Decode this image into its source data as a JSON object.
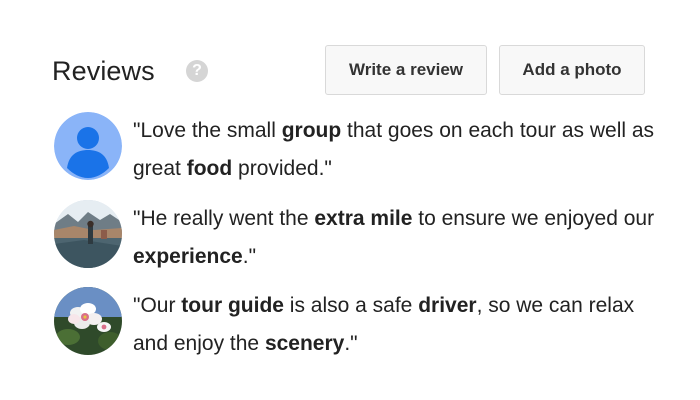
{
  "header": {
    "title": "Reviews",
    "help_icon_glyph": "?",
    "write_review_label": "Write a review",
    "add_photo_label": "Add a photo"
  },
  "reviews": [
    {
      "avatar": "default-user-avatar",
      "segments": [
        {
          "text": "\"Love the small ",
          "bold": false
        },
        {
          "text": "group",
          "bold": true
        },
        {
          "text": " that goes on each tour as well as great ",
          "bold": false
        },
        {
          "text": "food",
          "bold": true
        },
        {
          "text": " provided.\"",
          "bold": false
        }
      ]
    },
    {
      "avatar": "coastal-landscape-photo-avatar",
      "segments": [
        {
          "text": "\"He really went the ",
          "bold": false
        },
        {
          "text": "extra mile",
          "bold": true
        },
        {
          "text": " to ensure we enjoyed our ",
          "bold": false
        },
        {
          "text": "experience",
          "bold": true
        },
        {
          "text": ".\"",
          "bold": false
        }
      ]
    },
    {
      "avatar": "flower-blossom-photo-avatar",
      "segments": [
        {
          "text": "\"Our ",
          "bold": false
        },
        {
          "text": "tour guide",
          "bold": true
        },
        {
          "text": " is also a safe ",
          "bold": false
        },
        {
          "text": "driver",
          "bold": true
        },
        {
          "text": ", so we can relax and enjoy the ",
          "bold": false
        },
        {
          "text": "scenery",
          "bold": true
        },
        {
          "text": ".\"",
          "bold": false
        }
      ]
    }
  ],
  "colors": {
    "avatar_default_bg": "#8ab4f8",
    "avatar_default_figure": "#1a73e8",
    "help_icon_bg": "#d5d5d5",
    "button_bg": "#f8f8f8",
    "button_border": "#d9d9d9",
    "text": "#222222"
  }
}
